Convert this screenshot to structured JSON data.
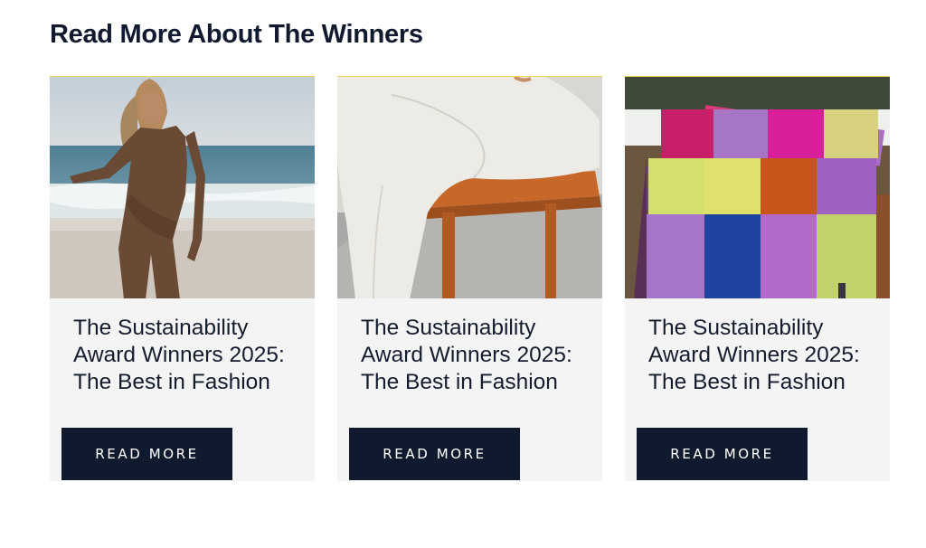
{
  "section": {
    "title": "Read More About The Winners"
  },
  "cards": [
    {
      "image_alt": "Woman in brown long-sleeve swimsuit on a beach",
      "title": "The Sustainability Award Winners 2025: The Best in Fashion",
      "button_label": "READ MORE"
    },
    {
      "image_alt": "Person in cream trousers seated on a wooden chair",
      "title": "The Sustainability Award Winners 2025: The Best in Fashion",
      "button_label": "READ MORE"
    },
    {
      "image_alt": "Colorful patchwork checked blanket draped outdoors",
      "title": "The Sustainability Award Winners 2025: The Best in Fashion",
      "button_label": "READ MORE"
    }
  ],
  "colors": {
    "heading": "#111a2e",
    "card_background": "#f4f4f4",
    "button_background": "#101a2e",
    "button_text": "#ffffff"
  }
}
